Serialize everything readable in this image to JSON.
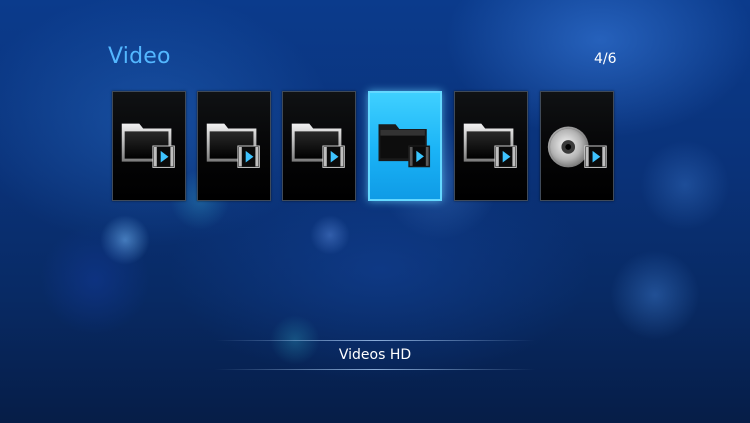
{
  "header": {
    "title": "Video",
    "page_indicator": "4/6"
  },
  "items": [
    {
      "icon": "video-folder-icon",
      "selected": false
    },
    {
      "icon": "video-folder-icon",
      "selected": false
    },
    {
      "icon": "video-folder-icon",
      "selected": false
    },
    {
      "icon": "video-folder-icon",
      "selected": true
    },
    {
      "icon": "video-folder-icon",
      "selected": false
    },
    {
      "icon": "video-disc-icon",
      "selected": false
    }
  ],
  "selected_label": "Videos HD",
  "colors": {
    "title": "#53b7ff",
    "selected_tile": "#1ab3f6",
    "background": "#0a3279"
  }
}
